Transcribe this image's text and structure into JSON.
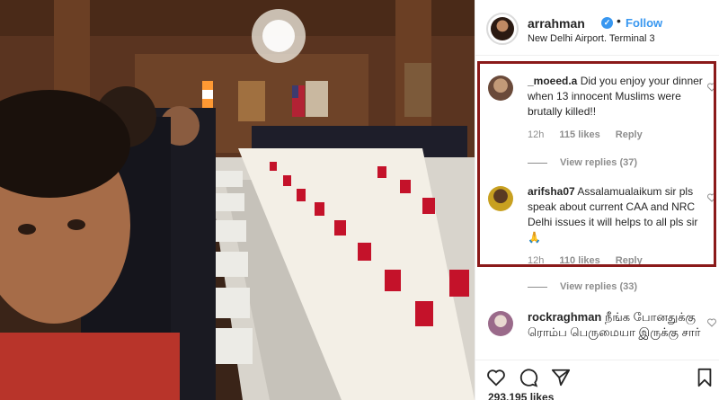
{
  "post": {
    "username": "arrahman",
    "follow_label": "Follow",
    "location": "New Delhi Airport. Terminal 3",
    "likes_total": "293,195 likes"
  },
  "comments": [
    {
      "username": "_moeed.a",
      "text": "Did you enjoy your dinner when 13 innocent Muslims were brutally killed!!",
      "time": "12h",
      "likes": "115 likes",
      "reply_label": "Reply",
      "view_replies": "View replies (37)"
    },
    {
      "username": "arifsha07",
      "text": "Assalamualaikum sir pls speak about current CAA and NRC Delhi issues it will helps to all pls sir🙏",
      "time": "12h",
      "likes": "110 likes",
      "reply_label": "Reply",
      "view_replies": "View replies (33)"
    },
    {
      "username": "rockraghman",
      "text": "நீங்க போனதுக்கு ரொம்ப பெருமையா இருக்கு சார்"
    }
  ],
  "colors": {
    "accent": "#3897f0",
    "highlight_border": "#8b1a1a",
    "muted": "#8e8e8e"
  },
  "icons": [
    "verified-badge-icon",
    "heart-icon",
    "comment-icon",
    "share-icon",
    "save-icon"
  ]
}
